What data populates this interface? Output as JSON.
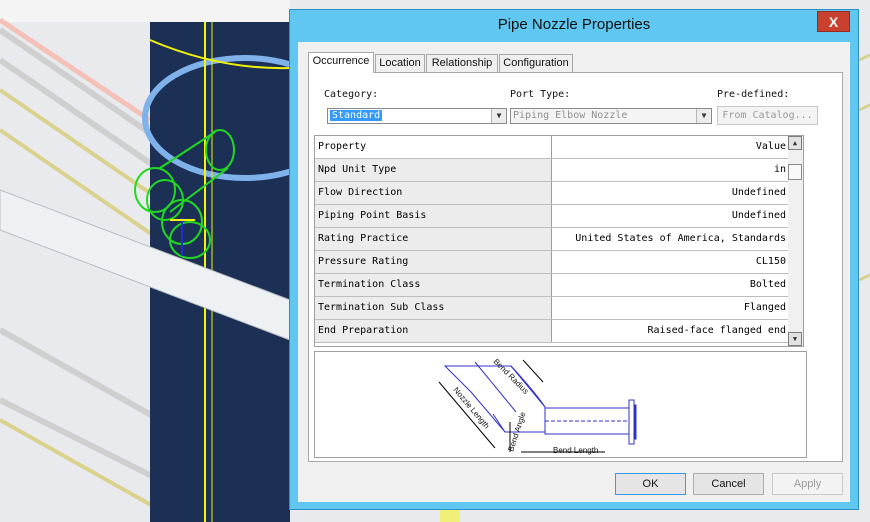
{
  "dialog": {
    "title": "Pipe Nozzle Properties",
    "close_glyph": "X",
    "tabs": [
      {
        "label": "Occurrence",
        "active": true
      },
      {
        "label": "Location",
        "active": false
      },
      {
        "label": "Relationship",
        "active": false
      },
      {
        "label": "Configuration",
        "active": false
      }
    ],
    "category": {
      "label": "Category:",
      "value": "Standard"
    },
    "port_type": {
      "label": "Port Type:",
      "value": "Piping Elbow Nozzle"
    },
    "predefined": {
      "label": "Pre-defined:",
      "button": "From Catalog..."
    },
    "grid": {
      "header": {
        "name": "Property",
        "value": "Value"
      },
      "rows": [
        {
          "name": "Npd Unit Type",
          "value": "in"
        },
        {
          "name": "Flow Direction",
          "value": "Undefined"
        },
        {
          "name": "Piping Point Basis",
          "value": "Undefined"
        },
        {
          "name": "Rating Practice",
          "value": "United States of America, Standards"
        },
        {
          "name": "Pressure Rating",
          "value": "CL150"
        },
        {
          "name": "Termination Class",
          "value": "Bolted"
        },
        {
          "name": "Termination Sub Class",
          "value": "Flanged"
        },
        {
          "name": "End Preparation",
          "value": "Raised-face flanged end"
        }
      ]
    },
    "diagram": {
      "bend_radius": "Bend Radius",
      "nozzle_length": "Nozzle Length",
      "bend_angle": "Bend Angle",
      "bend_length": "Bend Length"
    },
    "buttons": {
      "ok": "OK",
      "cancel": "Cancel",
      "apply": "Apply"
    }
  },
  "colors": {
    "title_bar": "#5fc7f0",
    "close_button": "#c8412f",
    "selection": "#3399ff",
    "diagram_lines": "#3030c8",
    "vessel": "#1c2f55",
    "selected_part": "#22d822",
    "centerline": "#f2f20a"
  },
  "icons": {
    "close": "close-icon",
    "dropdown": "chevron-down-icon",
    "scroll_up": "scroll-up-icon",
    "scroll_down": "scroll-down-icon"
  }
}
